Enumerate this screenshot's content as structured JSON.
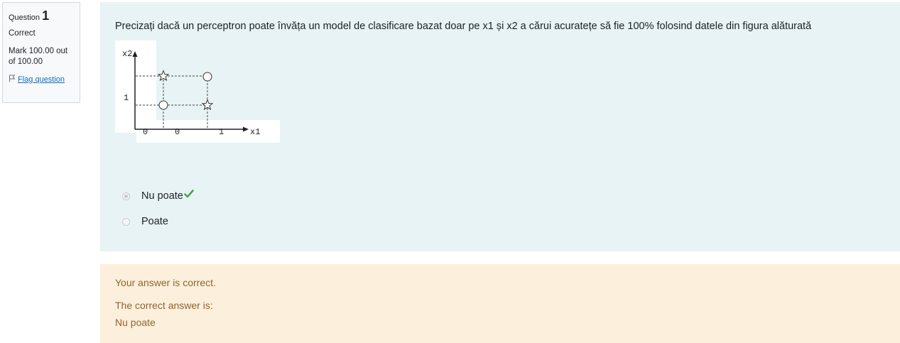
{
  "question_info": {
    "question_label": "Question",
    "question_number": "1",
    "state": "Correct",
    "grade": "Mark 100.00 out of 100.00",
    "flag_label": "Flag question"
  },
  "question": {
    "text": "Precizați dacă un perceptron poate învăța un model de clasificare bazat doar pe x1 și x2 a cărui acuratețe să fie 100% folosind datele din figura alăturată",
    "figure": {
      "y_axis_label": "x2",
      "x_axis_label": "x1",
      "y_tick": "1",
      "x_ticks": [
        "0",
        "0",
        "1"
      ]
    },
    "answers": [
      {
        "label": "Nu poate",
        "checked": true,
        "correct": true
      },
      {
        "label": "Poate",
        "checked": false,
        "correct": false
      }
    ]
  },
  "feedback": {
    "status": "Your answer is correct.",
    "correct_answer_label": "The correct answer is:",
    "correct_answer": "Nu poate"
  },
  "colors": {
    "formulation_bg": "#e7f3f5",
    "feedback_bg": "#fcefdc",
    "feedback_text": "#8e662e",
    "correct_check": "#4aa54a",
    "link": "#0f6cbf"
  }
}
